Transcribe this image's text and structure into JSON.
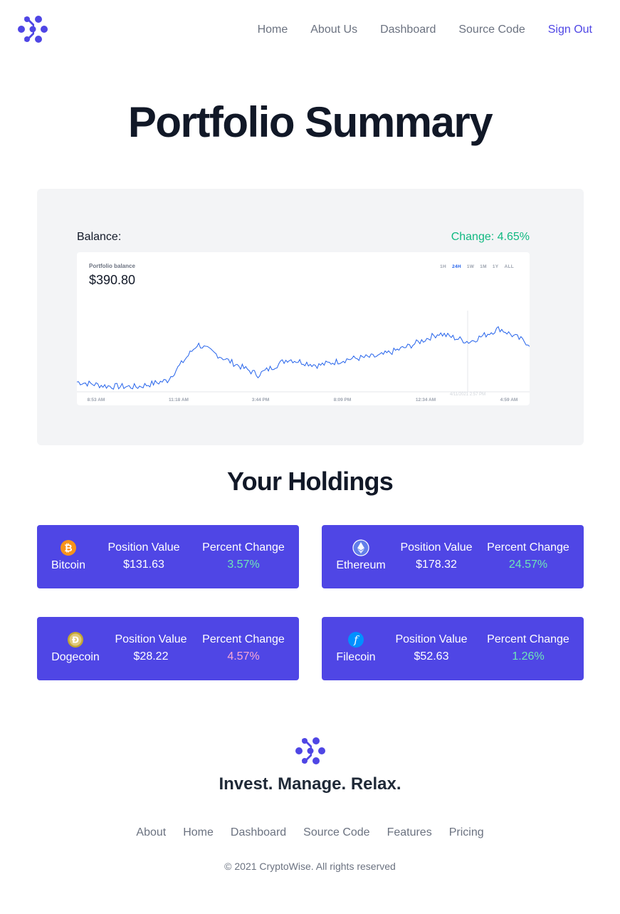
{
  "nav": {
    "logo_icon": "cryptowise-logo-icon",
    "links": [
      "Home",
      "About Us",
      "Dashboard",
      "Source Code"
    ],
    "signout": "Sign Out"
  },
  "page_title": "Portfolio Summary",
  "summary": {
    "balance_label": "Balance:",
    "change_label": "Change: 4.65%",
    "chart_card": {
      "label": "Portfolio balance",
      "value": "$390.80",
      "ranges": [
        "1H",
        "24H",
        "1W",
        "1M",
        "1Y",
        "ALL"
      ],
      "active_range": "24H",
      "x_ticks": [
        "8:53 AM",
        "11:18 AM",
        "3:44 PM",
        "8:09 PM",
        "12:34 AM",
        "4:59 AM"
      ],
      "hover_label": "4/11/2021 2:57 PM"
    }
  },
  "holdings_title": "Your Holdings",
  "holdings": [
    {
      "coin": "Bitcoin",
      "icon": "bitcoin-icon",
      "value_label": "Position Value",
      "value": "$131.63",
      "change_label": "Percent Change",
      "change": "3.57%",
      "direction": "up"
    },
    {
      "coin": "Ethereum",
      "icon": "ethereum-icon",
      "value_label": "Position Value",
      "value": "$178.32",
      "change_label": "Percent Change",
      "change": "24.57%",
      "direction": "up"
    },
    {
      "coin": "Dogecoin",
      "icon": "dogecoin-icon",
      "value_label": "Position Value",
      "value": "$28.22",
      "change_label": "Percent Change",
      "change": "4.57%",
      "direction": "down"
    },
    {
      "coin": "Filecoin",
      "icon": "filecoin-icon",
      "value_label": "Position Value",
      "value": "$52.63",
      "change_label": "Percent Change",
      "change": "1.26%",
      "direction": "up"
    }
  ],
  "footer": {
    "tagline": "Invest. Manage. Relax.",
    "links": [
      "About",
      "Home",
      "Dashboard",
      "Source Code",
      "Features",
      "Pricing"
    ],
    "copyright": "© 2021 CryptoWise. All rights reserved"
  },
  "colors": {
    "brand": "#4f46e5",
    "positive_change": "#10b981",
    "card_positive": "#6ee7b7",
    "card_negative": "#f9a8d4",
    "chart_line": "#2563eb"
  },
  "chart_data": {
    "type": "line",
    "title": "Portfolio balance",
    "x": [
      "8:53 AM",
      "11:18 AM",
      "3:44 PM",
      "8:09 PM",
      "12:34 AM",
      "4:59 AM"
    ],
    "series": [
      {
        "values": [
          0.1,
          0.04,
          0.03,
          0.12,
          0.63,
          0.4,
          0.2,
          0.42,
          0.33,
          0.42,
          0.46,
          0.6,
          0.78,
          0.66,
          0.85,
          0.63
        ]
      }
    ],
    "grid": false,
    "note_units": "relative"
  }
}
